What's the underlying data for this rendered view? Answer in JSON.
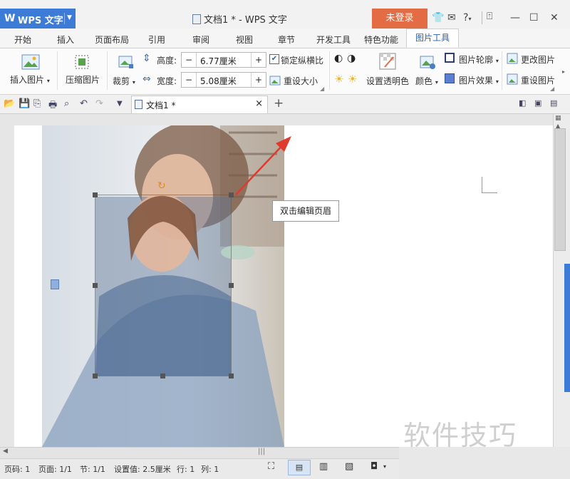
{
  "titlebar": {
    "app_name": "WPS 文字",
    "window_title": "文档1 * - WPS 文字",
    "login_button": "未登录",
    "icons": [
      "shirt-icon",
      "chat-icon",
      "help-icon",
      "upload-icon",
      "minimize-icon",
      "maximize-icon",
      "close-icon"
    ],
    "help_label": "?"
  },
  "ribbon_tabs": [
    "开始",
    "插入",
    "页面布局",
    "引用",
    "审阅",
    "视图",
    "章节",
    "开发工具",
    "特色功能",
    "图片工具"
  ],
  "active_tab": "图片工具",
  "ribbon": {
    "insert_picture": "插入图片",
    "compress_picture": "压缩图片",
    "crop": "裁剪",
    "height_label": "高度:",
    "height_value": "6.77厘米",
    "width_label": "宽度:",
    "width_value": "5.08厘米",
    "minus": "−",
    "plus": "+",
    "lock_ratio": "锁定纵横比",
    "lock_ratio_checked": true,
    "reset_size": "重设大小",
    "set_transparent": "设置透明色",
    "color": "颜色",
    "picture_outline": "图片轮廓",
    "picture_effects": "图片效果",
    "change_picture": "更改图片",
    "reset_picture": "重设图片"
  },
  "quickbar": {
    "doc_tab": "文档1 *",
    "close": "×",
    "add": "+"
  },
  "document": {
    "tooltip": "双击编辑页眉"
  },
  "status": {
    "page_no": "页码: 1",
    "pages": "页面: 1/1",
    "section": "节: 1/1",
    "setting": "设置值: 2.5厘米",
    "row": "行: 1",
    "col": "列: 1"
  },
  "watermark": "软件技巧",
  "colors": {
    "app_blue": "#3c7bd6",
    "login_orange": "#e46c45",
    "active_tab_text": "#2b5fb0",
    "arrow_red": "#e03a2f"
  }
}
